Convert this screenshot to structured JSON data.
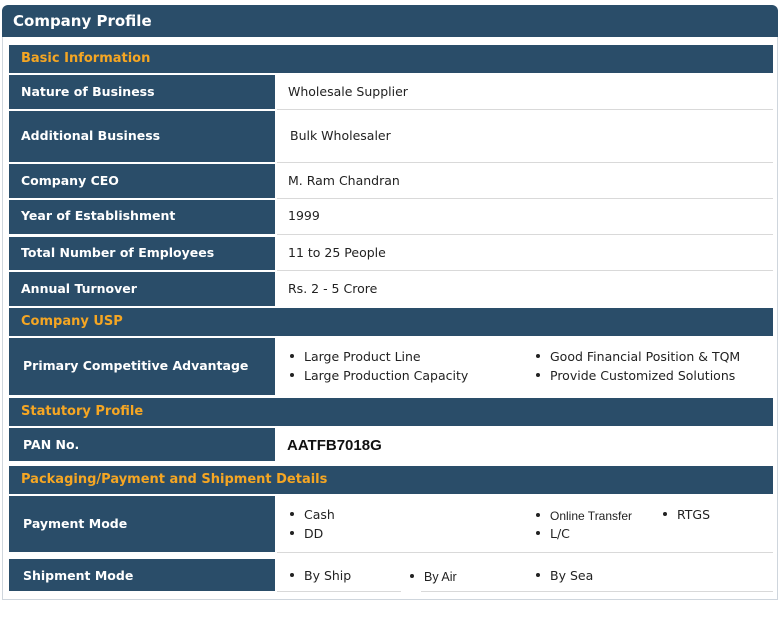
{
  "header": {
    "title": "Company Profile"
  },
  "sections": {
    "basic": "Basic Information",
    "usp": "Company USP",
    "statutory": "Statutory Profile",
    "packaging": "Packaging/Payment and Shipment Details"
  },
  "basic_info": {
    "nature_label": "Nature of Business",
    "nature_value": "Wholesale Supplier",
    "additional_label": "Additional Business",
    "additional_value": "Bulk Wholesaler",
    "ceo_label": "Company CEO",
    "ceo_value": "M. Ram Chandran",
    "year_label": "Year of Establishment",
    "year_value": "1999",
    "employees_label": "Total Number of Employees",
    "employees_value": "11 to 25 People",
    "turnover_label": "Annual Turnover",
    "turnover_value": "Rs. 2 - 5 Crore"
  },
  "usp": {
    "label": "Primary Competitive Advantage",
    "items": [
      "Large Product Line",
      "Large Production Capacity",
      "Good Financial Position & TQM",
      "Provide Customized Solutions"
    ]
  },
  "statutory": {
    "pan_label": "PAN No.",
    "pan_value": "AATFB7018G"
  },
  "payment": {
    "label": "Payment Mode",
    "items": [
      "Cash",
      "DD",
      "Online Transfer",
      "L/C",
      "RTGS"
    ]
  },
  "shipment": {
    "label": "Shipment Mode",
    "items": [
      "By Ship",
      "By Air",
      "By Sea"
    ]
  }
}
